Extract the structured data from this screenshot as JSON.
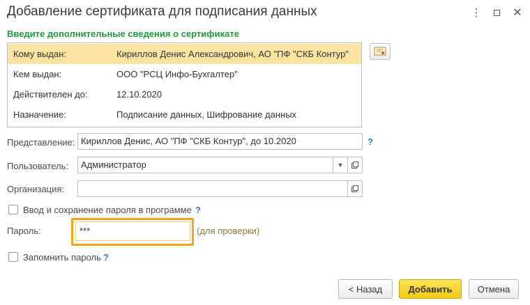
{
  "window": {
    "title": "Добавление сертификата для подписания данных",
    "more_icon": "vertical-dots-icon",
    "maximize_icon": "maximize-icon",
    "close_icon": "close-icon"
  },
  "subtitle": "Введите дополнительные сведения о сертификате",
  "certificate_info": [
    {
      "label": "Кому выдан:",
      "value": "Кириллов Денис Александрович, АО \"ПФ \"СКБ Контур\""
    },
    {
      "label": "Кем выдан:",
      "value": "ООО \"РСЦ Инфо-Бухгалтер\""
    },
    {
      "label": "Действителен до:",
      "value": "12.10.2020"
    },
    {
      "label": "Назначение:",
      "value": "Подписание данных, Шифрование данных"
    }
  ],
  "form": {
    "representation_label": "Представление:",
    "representation_value": "Кириллов Денис, АО \"ПФ \"СКБ Контур\", до 10.2020",
    "user_label": "Пользователь:",
    "user_value": "Администратор",
    "organization_label": "Организация:",
    "organization_value": "",
    "save_password_label": "Ввод и сохранение пароля в программе",
    "password_label": "Пароль:",
    "password_value": "***",
    "password_hint": "(для проверки)",
    "remember_password_label": "Запомнить пароль",
    "help_mark": "?"
  },
  "buttons": {
    "back": "< Назад",
    "add": "Добавить",
    "cancel": "Отмена"
  },
  "colors": {
    "accent_green": "#1f9a3e",
    "selected_row": "#fbe3a1",
    "focus_orange": "#f3a51c",
    "primary_button": "#f1cc15",
    "help_blue": "#2a7ac9"
  }
}
